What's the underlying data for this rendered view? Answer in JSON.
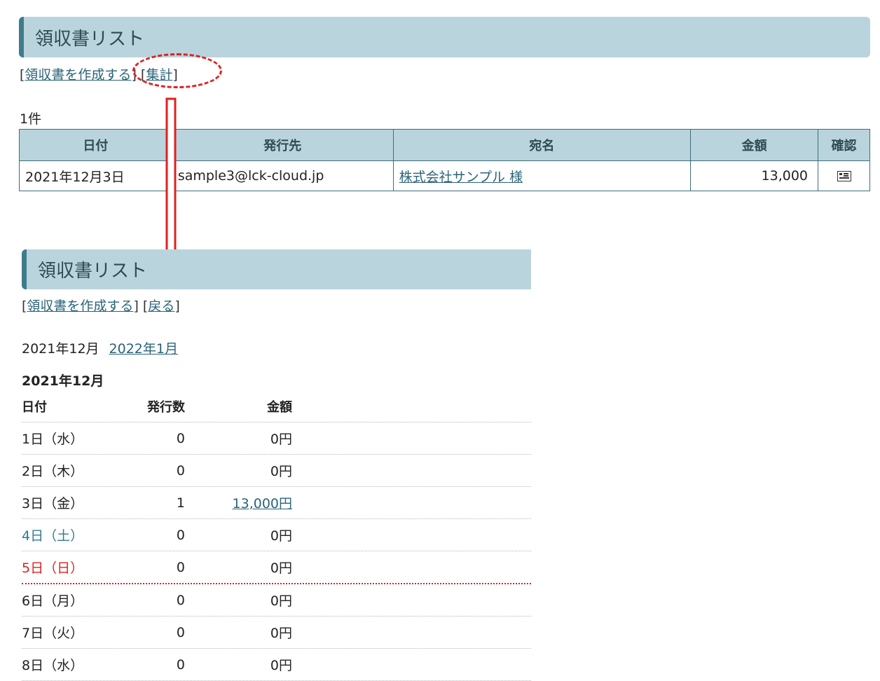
{
  "before": {
    "header_title": "領収書リスト",
    "links": {
      "create": "領収書を作成する",
      "summary": "集計"
    },
    "count": "1件",
    "table": {
      "headers": [
        "日付",
        "発行先",
        "宛名",
        "金額",
        "確認"
      ],
      "rows": [
        {
          "date": "2021年12月3日",
          "issuer": "sample3@lck-cloud.jp",
          "addressee": "株式会社サンプル 様",
          "amount": "13,000",
          "confirm_icon": "card-icon"
        }
      ]
    }
  },
  "after": {
    "header_title": "領収書リスト",
    "links": {
      "create": "領収書を作成する",
      "back": "戻る"
    },
    "month_nav": {
      "current": "2021年12月",
      "next": "2022年1月"
    },
    "month_heading": "2021年12月",
    "summary_headers": {
      "date": "日付",
      "count": "発行数",
      "amount": "金額"
    },
    "summary_rows": [
      {
        "date": "1日（水）",
        "count": "0",
        "amount": "0円",
        "kind": "weekday"
      },
      {
        "date": "2日（木）",
        "count": "0",
        "amount": "0円",
        "kind": "weekday"
      },
      {
        "date": "3日（金）",
        "count": "1",
        "amount": "13,000円",
        "kind": "weekday",
        "amount_link": true
      },
      {
        "date": "4日（土）",
        "count": "0",
        "amount": "0円",
        "kind": "saturday"
      },
      {
        "date": "5日（日）",
        "count": "0",
        "amount": "0円",
        "kind": "sunday"
      },
      {
        "date": "6日（月）",
        "count": "0",
        "amount": "0円",
        "kind": "weekday"
      },
      {
        "date": "7日（火）",
        "count": "0",
        "amount": "0円",
        "kind": "weekday"
      },
      {
        "date": "8日（水）",
        "count": "0",
        "amount": "0円",
        "kind": "weekday"
      }
    ]
  },
  "colors": {
    "header_bg": "#b9d4dc",
    "header_accent": "#3d7c8c",
    "link": "#2a6478",
    "saturday": "#2f7a95",
    "sunday": "#e02020",
    "annotation": "#e02020"
  }
}
